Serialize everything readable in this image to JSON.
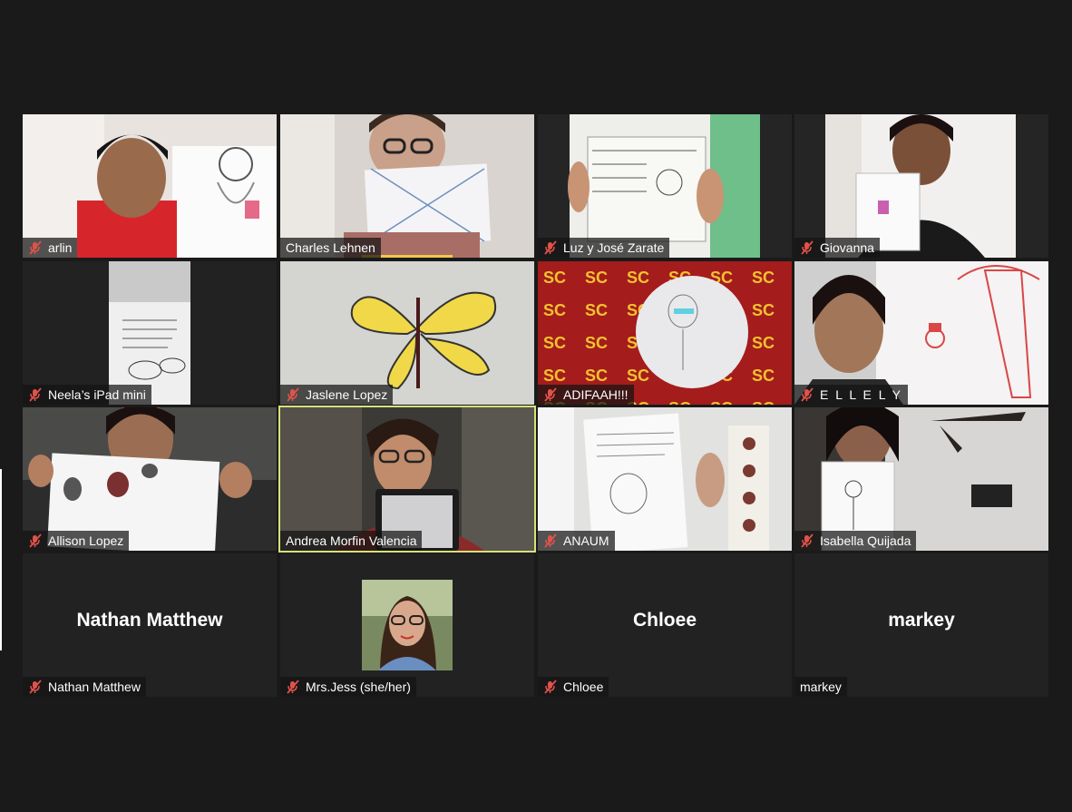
{
  "colors": {
    "background": "#1a1a1a",
    "active_speaker_border": "#d8e27a",
    "muted_icon": "#e0524a"
  },
  "participants": [
    {
      "name": "arlin",
      "muted": true
    },
    {
      "name": "Charles Lehnen",
      "muted": false
    },
    {
      "name": "Luz y José Zarate",
      "muted": true
    },
    {
      "name": "Giovanna",
      "muted": true
    },
    {
      "name": "Neela’s iPad mini",
      "muted": true
    },
    {
      "name": "Jaslene Lopez",
      "muted": true
    },
    {
      "name": "ADIFAAH!!!",
      "muted": true
    },
    {
      "name": "E L L E  L Y",
      "muted": true
    },
    {
      "name": "Allison Lopez",
      "muted": true
    },
    {
      "name": "Andrea Morfin Valencia",
      "muted": false
    },
    {
      "name": "ANAUM",
      "muted": true
    },
    {
      "name": "Isabella Quijada",
      "muted": true
    },
    {
      "name": "Nathan Matthew",
      "muted": true,
      "display_name": "Nathan Matthew"
    },
    {
      "name": "Mrs.Jess (she/her)",
      "muted": true
    },
    {
      "name": "Chloee",
      "muted": true,
      "display_name": "Chloee"
    },
    {
      "name": "markey",
      "muted": false,
      "display_name": "markey"
    }
  ]
}
